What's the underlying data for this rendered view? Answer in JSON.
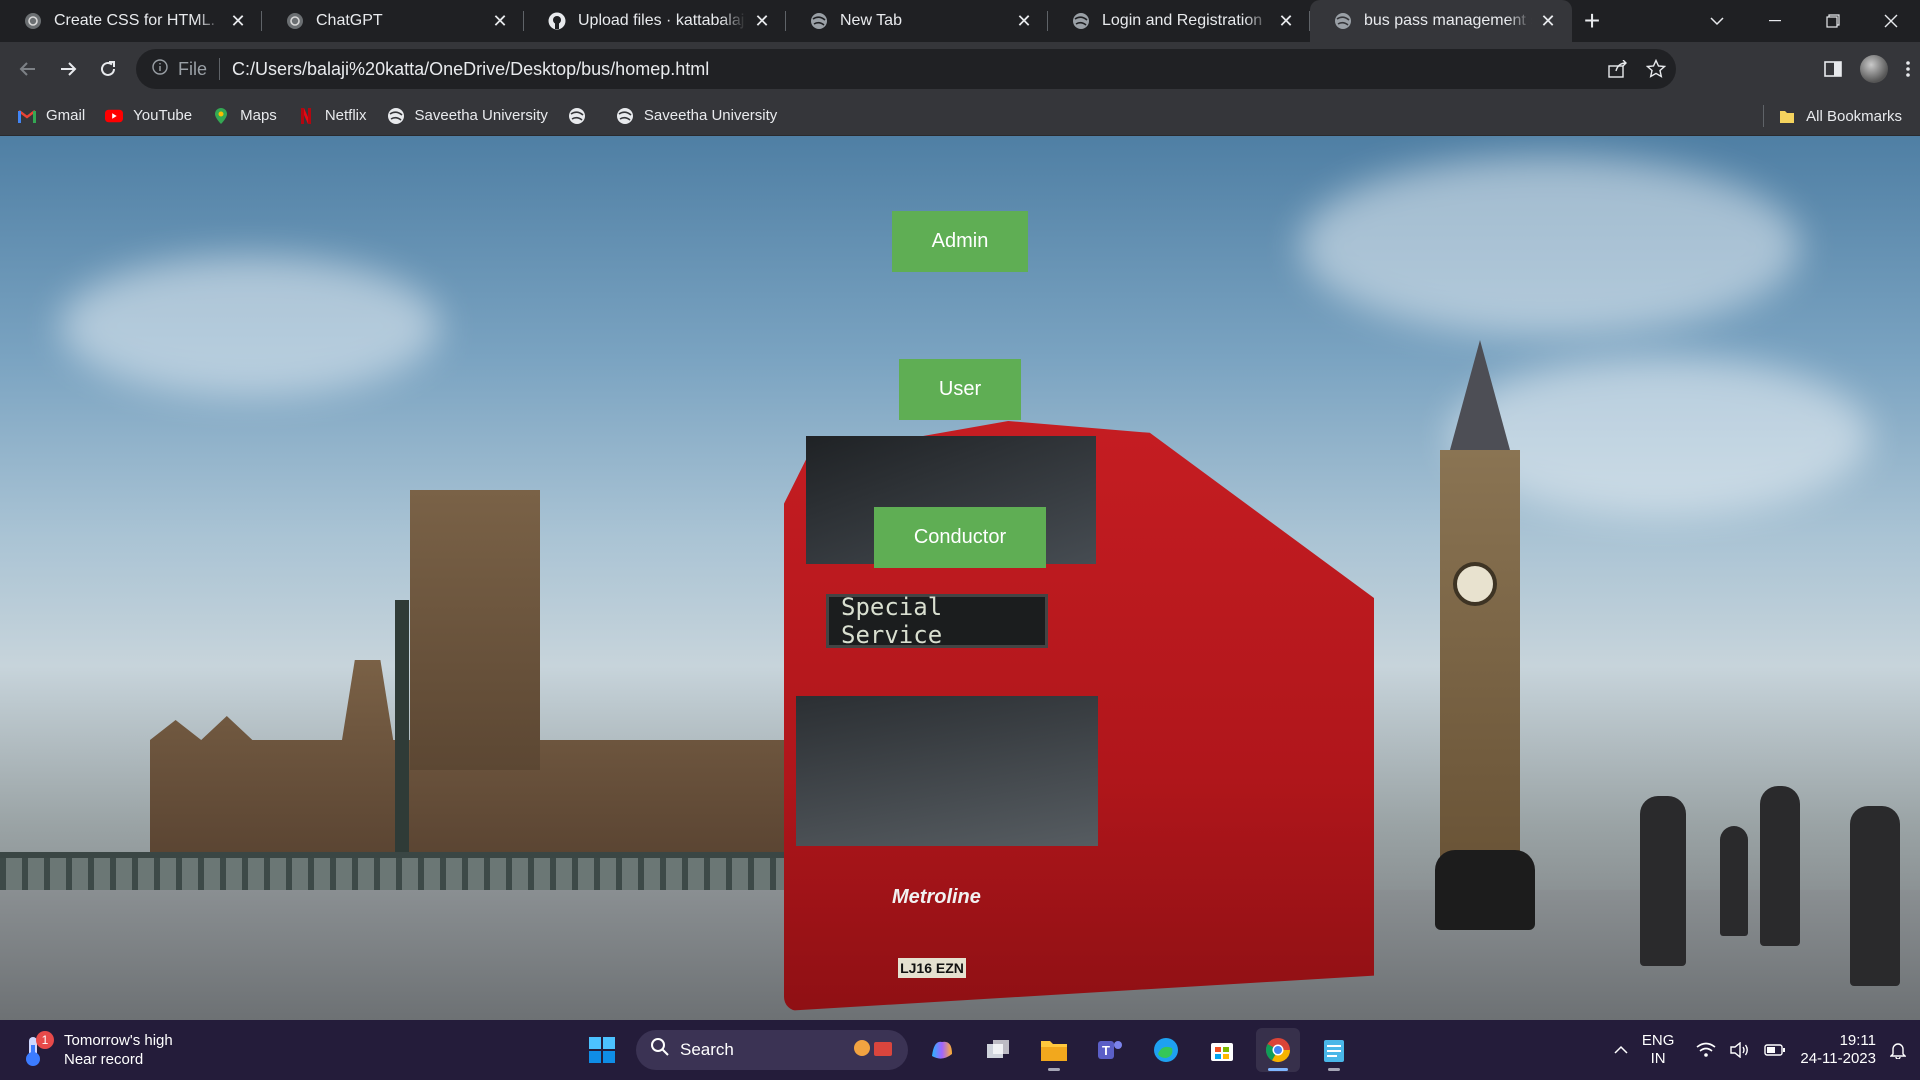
{
  "tabs": [
    {
      "title": "Create CSS for HTML.",
      "icon": "chatgpt-icon",
      "active": false
    },
    {
      "title": "ChatGPT",
      "icon": "chatgpt-icon",
      "active": false
    },
    {
      "title": "Upload files · kattabalaji/CSS",
      "icon": "github-icon",
      "active": false
    },
    {
      "title": "New Tab",
      "icon": "globe-icon",
      "active": false
    },
    {
      "title": "Login and Registration",
      "icon": "globe-icon",
      "active": false
    },
    {
      "title": "bus pass management system",
      "icon": "globe-icon",
      "active": true
    }
  ],
  "toolbar": {
    "scheme_label": "File",
    "url": "C:/Users/balaji%20katta/OneDrive/Desktop/bus/homep.html"
  },
  "bookmarks": [
    {
      "label": "Gmail",
      "icon": "gmail-icon"
    },
    {
      "label": "YouTube",
      "icon": "youtube-icon"
    },
    {
      "label": "Maps",
      "icon": "maps-icon"
    },
    {
      "label": "Netflix",
      "icon": "netflix-icon"
    },
    {
      "label": "Saveetha University",
      "icon": "globe-icon"
    },
    {
      "label": "",
      "icon": "globe-icon"
    },
    {
      "label": "Saveetha University",
      "icon": "globe-icon"
    }
  ],
  "bookmarks_all": "All Bookmarks",
  "page": {
    "buttons": {
      "admin": "Admin",
      "user": "User",
      "conductor": "Conductor"
    },
    "button_color": "#5fae54",
    "bus_sign": "Special Service",
    "bus_brand": "Metroline",
    "bus_plate": "LJ16 EZN"
  },
  "taskbar": {
    "weather_line1": "Tomorrow's high",
    "weather_line2": "Near record",
    "weather_badge": "1",
    "search_placeholder": "Search",
    "lang_line1": "ENG",
    "lang_line2": "IN",
    "time": "19:11",
    "date": "24-11-2023",
    "bg_color": "#241c3a"
  }
}
